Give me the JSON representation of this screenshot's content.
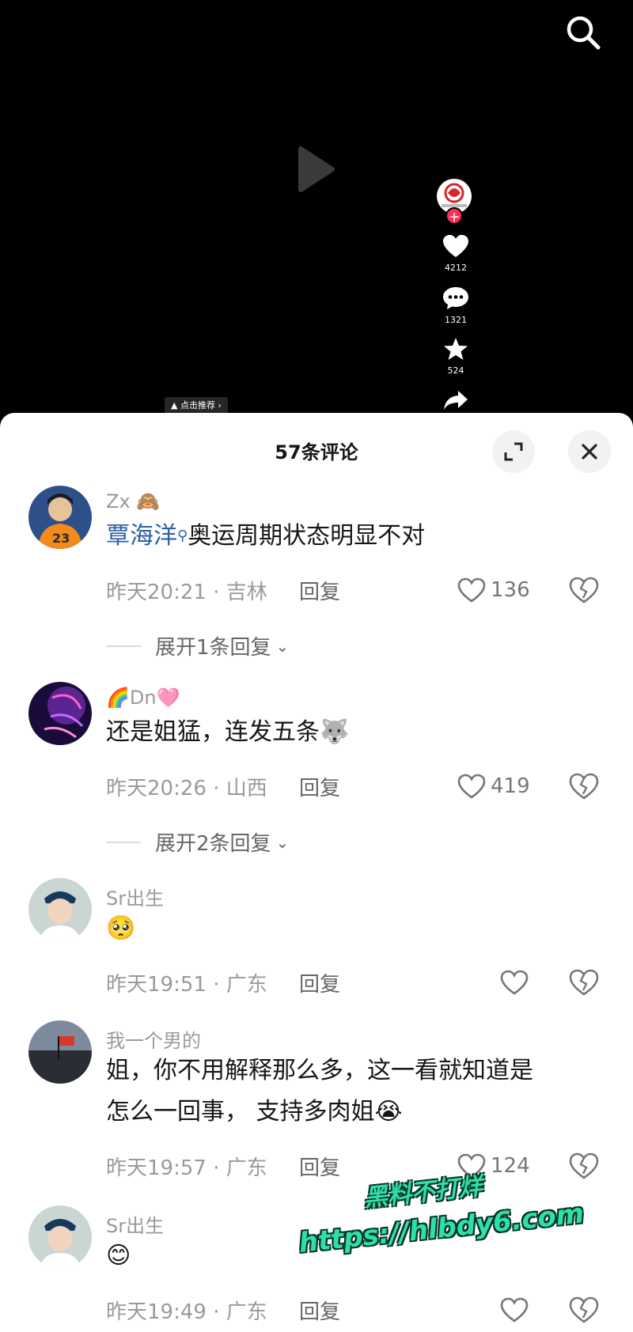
{
  "player": {
    "rail": {
      "like_count": "4212",
      "comment_count": "1321",
      "favorite_count": "524"
    },
    "recommend_label": "点击推荐"
  },
  "comments_panel": {
    "title": "57条评论",
    "comments": [
      {
        "user": "Zx",
        "mention": "覃海洋",
        "text": "奥运周期状态明显不对",
        "time_loc": "昨天20:21 · 吉林",
        "reply": "回复",
        "likes": "136",
        "expand": "展开1条回复"
      },
      {
        "user": "Dn",
        "text": "还是姐猛，连发五条",
        "time_loc": "昨天20:26 · 山西",
        "reply": "回复",
        "likes": "419",
        "expand": "展开2条回复"
      },
      {
        "user": "Sr出生",
        "text": "",
        "time_loc": "昨天19:51 · 广东",
        "reply": "回复",
        "likes": ""
      },
      {
        "user": "我一个男的",
        "text_line1": "姐，你不用解释那么多，这一看就知道是",
        "text_line2": "怎么一回事， 支持多肉姐",
        "time_loc": "昨天19:57 · 广东",
        "reply": "回复",
        "likes": "124"
      },
      {
        "user": "Sr出生",
        "text": "",
        "time_loc": "昨天19:49 · 广东",
        "reply": "回复",
        "likes": ""
      }
    ]
  },
  "watermark": {
    "line1": "黑料不打烊",
    "line2": "https://hlbdy6.com"
  },
  "icons": {
    "search": "search-icon",
    "play": "play-icon",
    "like": "heart-icon",
    "comment": "comment-bubble-icon",
    "favorite": "star-icon",
    "share": "share-arrow-icon",
    "expand": "expand-corners-icon",
    "close": "close-icon",
    "dislike": "broken-heart-icon"
  },
  "colors": {
    "accent": "#fe2c55",
    "mention": "#2e5fa6",
    "watermark": "#2fe0a6"
  }
}
